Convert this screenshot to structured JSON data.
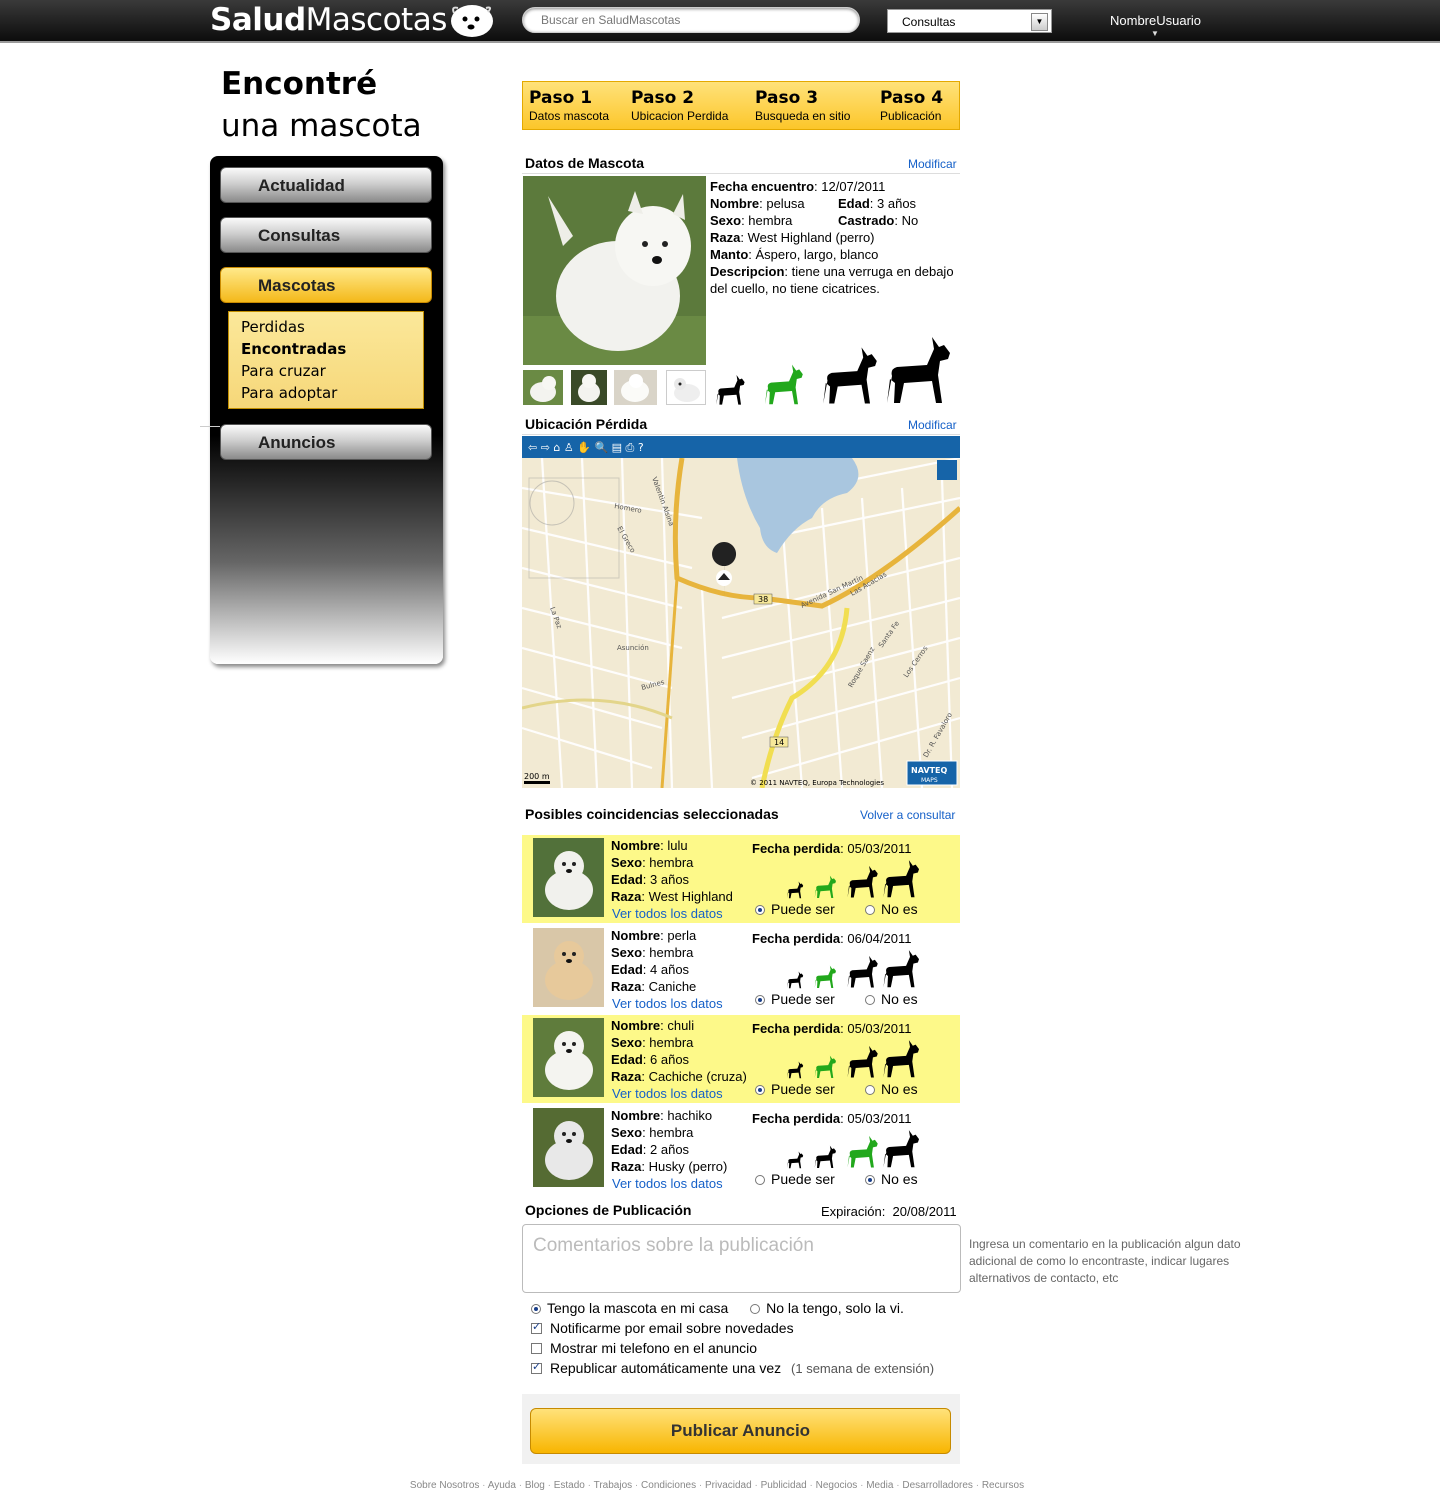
{
  "header": {
    "logo_bold": "Salud",
    "logo_light": "Mascotas",
    "search_placeholder": "Buscar en SaludMascotas",
    "category": "Consultas",
    "username": "NombreUsuario"
  },
  "page": {
    "title_line1": "Encontré",
    "title_line2": "una mascota"
  },
  "sidebar": {
    "items": [
      {
        "label": "Actualidad"
      },
      {
        "label": "Consultas"
      },
      {
        "label": "Mascotas"
      },
      {
        "label": "Anuncios"
      }
    ],
    "submenu": [
      "Perdidas",
      "Encontradas",
      "Para cruzar",
      "Para adoptar"
    ],
    "submenu_selected": "Encontradas"
  },
  "steps": [
    {
      "num": "Paso 1",
      "label": "Datos mascota"
    },
    {
      "num": "Paso 2",
      "label": "Ubicacion Perdida"
    },
    {
      "num": "Paso 3",
      "label": "Busqueda en sitio"
    },
    {
      "num": "Paso 4",
      "label": "Publicación"
    }
  ],
  "pet": {
    "section_title": "Datos de Mascota",
    "modify_label": "Modificar",
    "found_date_label": "Fecha encuentro",
    "found_date": ": 12/07/2011",
    "name_label": "Nombre",
    "name": ": pelusa",
    "age_label": "Edad",
    "age": ": 3 años",
    "sex_label": "Sexo",
    "sex": ":  hembra",
    "neutered_label": "Castrado",
    "neutered": ": No",
    "breed_label": "Raza",
    "breed": ": West Highland (perro)",
    "coat_label": "Manto",
    "coat": ": Áspero, largo, blanco",
    "desc_label": "Descripcion",
    "desc": ": tiene una verruga en debajo del cuello, no tiene cicatrices.",
    "size_selected": 2,
    "size_color": "#22a81c"
  },
  "location": {
    "section_title": "Ubicación Pérdida",
    "modify_label": "Modificar",
    "scale": "200 m",
    "copyright": "© 2011 NAVTEQ, Europa Technologies",
    "provider_line1": "NAVTEQ",
    "provider_line2": "MAPS",
    "road_1": "38",
    "road_2": "14",
    "streets": [
      "Avenida San Martín",
      "Asunción",
      "Bulnes",
      "El Greco",
      "Homero",
      "Las Acacias",
      "Los Cerros",
      "Santa Fe",
      "Valentin Alsina",
      "La Paz",
      "Roque Saenz",
      "Dr. R. Favaloro"
    ]
  },
  "matches": {
    "section_title": "Posibles coincidencias seleccionadas",
    "back_label": "Volver a consultar",
    "view_all_label": "Ver todos los datos",
    "maybe_label": "Puede ser",
    "no_label": "No es",
    "items": [
      {
        "name": ": lulu",
        "sex": ":  hembra",
        "age": ": 3 años",
        "breed": ": West Highland",
        "date": ": 05/03/2011",
        "size": 2,
        "choice": "maybe",
        "highlight": true
      },
      {
        "name": ": perla",
        "sex": ":  hembra",
        "age": ": 4 años",
        "breed": ": Caniche",
        "date": ": 06/04/2011",
        "size": 2,
        "choice": "maybe",
        "highlight": false
      },
      {
        "name": ": chuli",
        "sex": ":  hembra",
        "age": ": 6 años",
        "breed": ": Cachiche (cruza)",
        "date": ": 05/03/2011",
        "size": 2,
        "choice": "maybe",
        "highlight": true
      },
      {
        "name": ": hachiko",
        "sex": ":  hembra",
        "age": ": 2 años",
        "breed": ": Husky (perro)",
        "date": ": 05/03/2011",
        "size": 3,
        "choice": "no",
        "highlight": false
      }
    ],
    "labels": {
      "name": "Nombre",
      "sex": "Sexo",
      "age": "Edad",
      "breed": "Raza",
      "date": "Fecha perdida"
    }
  },
  "publication": {
    "section_title": "Opciones de Publicación",
    "expiration_label": "Expiración:",
    "expiration": "20/08/2011",
    "comment_placeholder": "Comentarios sobre la publicación",
    "hint": "Ingresa un comentario en la publicación algun dato adicional de como lo encontraste, indicar lugares alternativos de contacto, etc",
    "have_pet": "Tengo la mascota en mi casa",
    "dont_have": "No la tengo, solo la vi.",
    "notify": "Notificarme por email sobre novedades",
    "show_phone": "Mostrar mi telefono en el anuncio",
    "republish": "Republicar automáticamente una vez",
    "republish_note": "(1 semana de extensión)",
    "publish_button": "Publicar Anuncio"
  },
  "footer": [
    "Sobre Nosotros",
    "Ayuda",
    "Blog",
    "Estado",
    "Trabajos",
    "Condiciones",
    "Privacidad",
    "Publicidad",
    "Negocios",
    "Media",
    "Desarrolladores",
    "Recursos"
  ],
  "colors": {
    "accent": "#fcc62a",
    "highlight": "#fdf989",
    "link": "#1560c8",
    "map_toolbar": "#1664a8"
  }
}
